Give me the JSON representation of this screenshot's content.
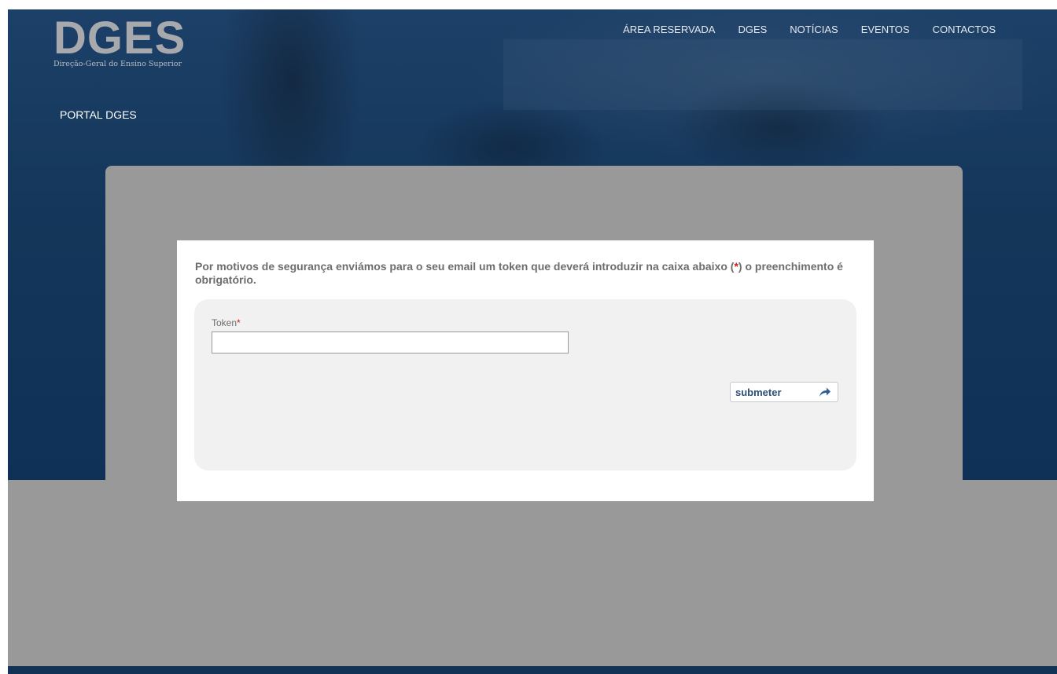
{
  "header": {
    "logo_text": "DGES",
    "logo_subtitle": "Direção-Geral do Ensino Superior",
    "nav": [
      "ÁREA RESERVADA",
      "DGES",
      "NOTÍCIAS",
      "EVENTOS",
      "CONTACTOS"
    ]
  },
  "portal_title": "PORTAL DGES",
  "dialog": {
    "message_before": "Por motivos de segurança enviámos para o seu email um token que deverá introduzir na caixa abaixo (",
    "required_marker": "*",
    "message_after": ") o preenchimento é obrigatório.",
    "token_label": "Token",
    "token_required": "*",
    "token_value": "",
    "submit_label": "submeter",
    "submit_icon": "share-arrow-icon"
  },
  "colors": {
    "header_blue": "#143659",
    "panel_gray": "#999999",
    "required_red": "#c81e1e",
    "button_text": "#2c4f78"
  }
}
